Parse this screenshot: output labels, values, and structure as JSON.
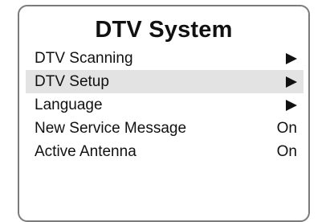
{
  "menu": {
    "title": "DTV System",
    "items": [
      {
        "label": "DTV Scanning",
        "indicator": "right-arrow-icon",
        "selected": false
      },
      {
        "label": "DTV Setup",
        "indicator": "right-arrow-icon",
        "selected": true
      },
      {
        "label": "Language",
        "indicator": "right-arrow-icon",
        "selected": false
      },
      {
        "label": "New Service Message",
        "value": "On",
        "selected": false
      },
      {
        "label": "Active Antenna",
        "value": "On",
        "selected": false
      }
    ]
  },
  "colors": {
    "border": "#7b7b7b",
    "selection_highlight": "#e3e3e3",
    "text": "#111111"
  }
}
